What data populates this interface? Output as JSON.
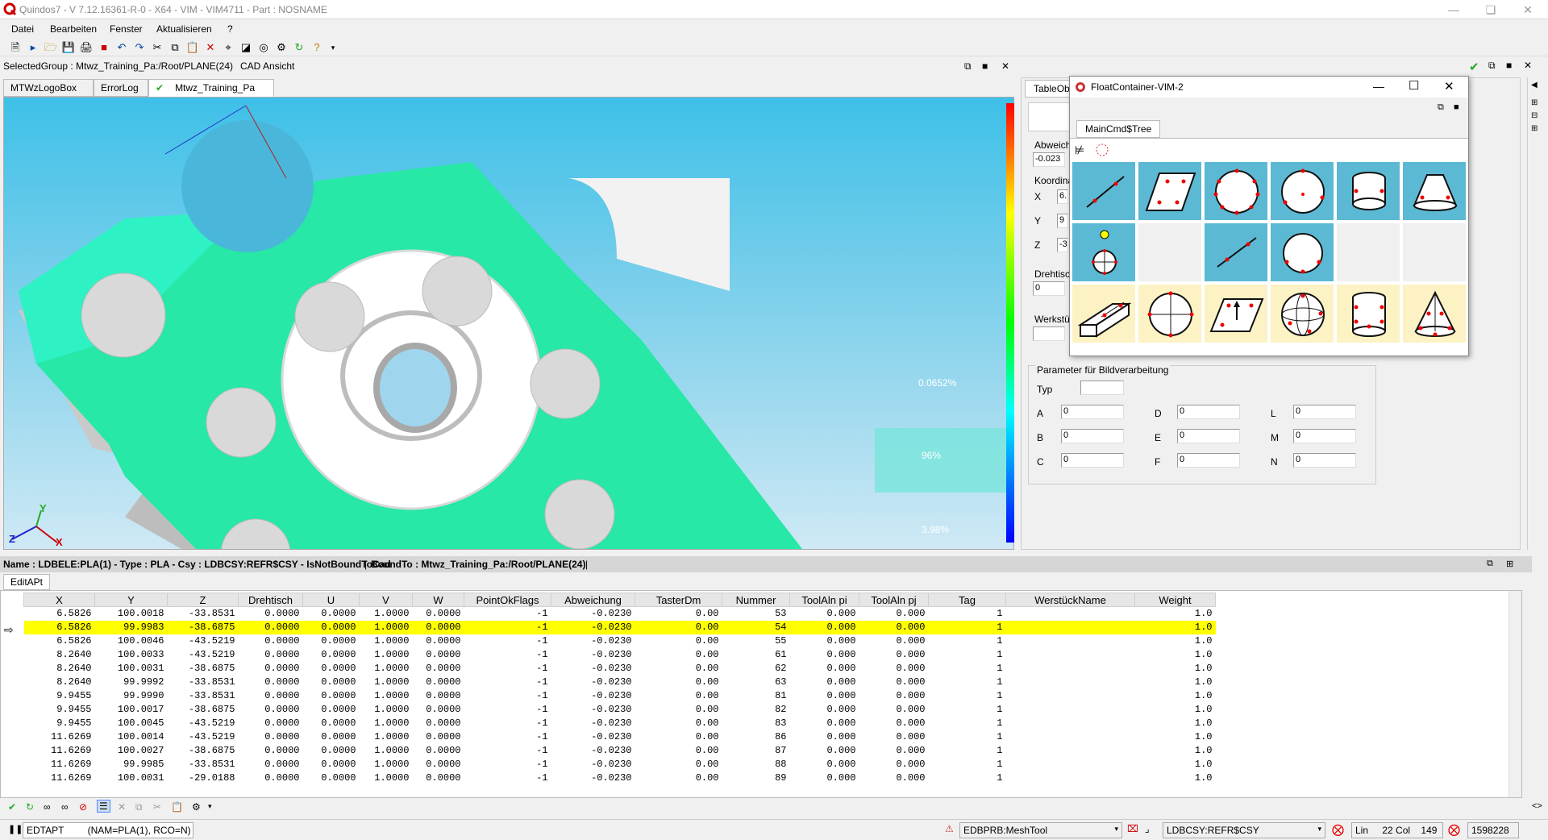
{
  "window": {
    "title": "Quindos7 - V 7.12.16361-R-0 - X64 - VIM - VIM4711 - Part : NOSNAME"
  },
  "menu": [
    "Datei",
    "Bearbeiten",
    "Fenster",
    "Aktualisieren",
    "?"
  ],
  "selected_group": {
    "label": "SelectedGroup : Mtwz_Training_Pa:/Root/PLANE(24)",
    "view": "CAD Ansicht"
  },
  "tabs": [
    "MTWzLogoBox",
    "ErrorLog",
    "Mtwz_Training_Pa"
  ],
  "viewport": {
    "percent_labels": [
      "0.0652%",
      "96%",
      "3.98%"
    ],
    "axes": {
      "x": "X",
      "y": "Y",
      "z": "Z"
    }
  },
  "right_panel": {
    "tab_label": "TableOb",
    "abweichung_label": "Abweich",
    "abweichung_value": "-0.023",
    "koordinaten_label": "Koordina",
    "coord_labels": [
      "X",
      "Y",
      "Z"
    ],
    "coord_values": [
      "6.",
      "9",
      "-3"
    ],
    "drehtisch_label": "Drehtisc",
    "drehtisch_value": "0",
    "werkstueck_label": "Werkstü",
    "bild_section_title": "Parameter für Bildverarbeitung",
    "typ_label": "Typ",
    "params": [
      {
        "label": "A",
        "value": "0"
      },
      {
        "label": "D",
        "value": "0"
      },
      {
        "label": "L",
        "value": "0"
      },
      {
        "label": "B",
        "value": "0"
      },
      {
        "label": "E",
        "value": "0"
      },
      {
        "label": "M",
        "value": "0"
      },
      {
        "label": "C",
        "value": "0"
      },
      {
        "label": "F",
        "value": "0"
      },
      {
        "label": "N",
        "value": "0"
      }
    ]
  },
  "float_container": {
    "title": "FloatContainer-VIM-2",
    "tab": "MainCmd$Tree",
    "row1_icons": [
      "line-fit-icon",
      "plane-parallelogram-icon",
      "circle-points-icon",
      "circle-three-points-icon",
      "cylinder-icon",
      "cone-icon"
    ],
    "row2_icons": [
      "sun-star-icon",
      "line-icon",
      "circle-arc-icon"
    ],
    "row3_icons": [
      "box-line-icon",
      "crosshair-circle-icon",
      "plane-normal-icon",
      "sphere-icon",
      "cylinder-points-icon",
      "cone-points-icon"
    ]
  },
  "name_bar": {
    "text": "Name : LDBELE:PLA(1) - Type : PLA - Csy : LDBCSY:REFR$CSY - IsNotBoundToCad",
    "bound": "BoundTo : Mtwz_Training_Pa:/Root/PLANE(24)"
  },
  "grid": {
    "tab": "EditAPt",
    "columns": [
      "X",
      "Y",
      "Z",
      "Drehtisch",
      "U",
      "V",
      "W",
      "PointOkFlags",
      "Abweichung",
      "TasterDm",
      "Nummer",
      "ToolAln pi",
      "ToolAln pj",
      "Tag",
      "WerstückName",
      "Weight"
    ],
    "rows": [
      [
        "6.5826",
        "100.0018",
        "-33.8531",
        "0.0000",
        "0.0000",
        "1.0000",
        "0.0000",
        "-1",
        "-0.0230",
        "0.00",
        "53",
        "0.000",
        "0.000",
        "1",
        "",
        "1.0"
      ],
      [
        "6.5826",
        "99.9983",
        "-38.6875",
        "0.0000",
        "0.0000",
        "1.0000",
        "0.0000",
        "-1",
        "-0.0230",
        "0.00",
        "54",
        "0.000",
        "0.000",
        "1",
        "",
        "1.0"
      ],
      [
        "6.5826",
        "100.0046",
        "-43.5219",
        "0.0000",
        "0.0000",
        "1.0000",
        "0.0000",
        "-1",
        "-0.0230",
        "0.00",
        "55",
        "0.000",
        "0.000",
        "1",
        "",
        "1.0"
      ],
      [
        "8.2640",
        "100.0033",
        "-43.5219",
        "0.0000",
        "0.0000",
        "1.0000",
        "0.0000",
        "-1",
        "-0.0230",
        "0.00",
        "61",
        "0.000",
        "0.000",
        "1",
        "",
        "1.0"
      ],
      [
        "8.2640",
        "100.0031",
        "-38.6875",
        "0.0000",
        "0.0000",
        "1.0000",
        "0.0000",
        "-1",
        "-0.0230",
        "0.00",
        "62",
        "0.000",
        "0.000",
        "1",
        "",
        "1.0"
      ],
      [
        "8.2640",
        "99.9992",
        "-33.8531",
        "0.0000",
        "0.0000",
        "1.0000",
        "0.0000",
        "-1",
        "-0.0230",
        "0.00",
        "63",
        "0.000",
        "0.000",
        "1",
        "",
        "1.0"
      ],
      [
        "9.9455",
        "99.9990",
        "-33.8531",
        "0.0000",
        "0.0000",
        "1.0000",
        "0.0000",
        "-1",
        "-0.0230",
        "0.00",
        "81",
        "0.000",
        "0.000",
        "1",
        "",
        "1.0"
      ],
      [
        "9.9455",
        "100.0017",
        "-38.6875",
        "0.0000",
        "0.0000",
        "1.0000",
        "0.0000",
        "-1",
        "-0.0230",
        "0.00",
        "82",
        "0.000",
        "0.000",
        "1",
        "",
        "1.0"
      ],
      [
        "9.9455",
        "100.0045",
        "-43.5219",
        "0.0000",
        "0.0000",
        "1.0000",
        "0.0000",
        "-1",
        "-0.0230",
        "0.00",
        "83",
        "0.000",
        "0.000",
        "1",
        "",
        "1.0"
      ],
      [
        "11.6269",
        "100.0014",
        "-43.5219",
        "0.0000",
        "0.0000",
        "1.0000",
        "0.0000",
        "-1",
        "-0.0230",
        "0.00",
        "86",
        "0.000",
        "0.000",
        "1",
        "",
        "1.0"
      ],
      [
        "11.6269",
        "100.0027",
        "-38.6875",
        "0.0000",
        "0.0000",
        "1.0000",
        "0.0000",
        "-1",
        "-0.0230",
        "0.00",
        "87",
        "0.000",
        "0.000",
        "1",
        "",
        "1.0"
      ],
      [
        "11.6269",
        "99.9985",
        "-33.8531",
        "0.0000",
        "0.0000",
        "1.0000",
        "0.0000",
        "-1",
        "-0.0230",
        "0.00",
        "88",
        "0.000",
        "0.000",
        "1",
        "",
        "1.0"
      ],
      [
        "11.6269",
        "100.0031",
        "-29.0188",
        "0.0000",
        "0.0000",
        "1.0000",
        "0.0000",
        "-1",
        "-0.0230",
        "0.00",
        "89",
        "0.000",
        "0.000",
        "1",
        "",
        "1.0"
      ]
    ],
    "highlight_row": 1
  },
  "statusbar": {
    "command": "EDTAPT",
    "args": "(NAM=PLA(1), RCO=N)",
    "meshtool": "EDBPRB:MeshTool",
    "csy": "LDBCSY:REFR$CSY",
    "lin": "Lin",
    "col": "22 Col",
    "colnum": "149",
    "memory": "1598228"
  },
  "colors": {
    "highlight": "#ffff00",
    "teal_cell": "#5cb9d3",
    "yellow_cell": "#fcf2c3",
    "part_green": "#27e8a6"
  }
}
